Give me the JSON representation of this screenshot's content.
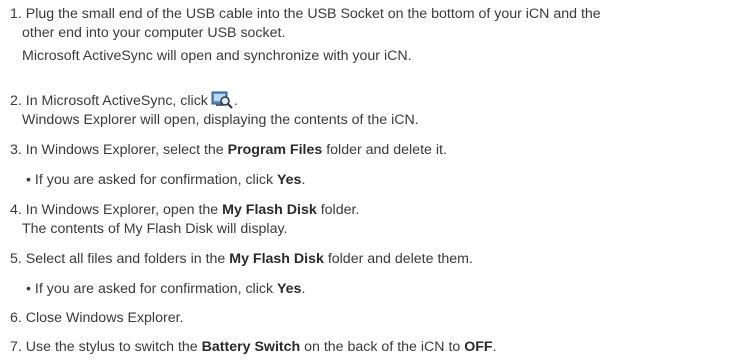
{
  "steps": [
    {
      "line1": "1. Plug the small end of the USB cable into the USB Socket on the bottom of your iCN and the",
      "line2": "other end into your computer USB socket.",
      "line3": "Microsoft ActiveSync will open and synchronize with your iCN."
    },
    {
      "pre": "2. In Microsoft ActiveSync, click",
      "post": ".",
      "line2": "Windows Explorer will open, displaying the contents of the iCN.",
      "icon": "explore-icon"
    },
    {
      "pre": "3. In Windows Explorer, select the ",
      "bold": "Program Files",
      "post": " folder and delete it.",
      "bullet_pre": "• If you are asked for confirmation, click ",
      "bullet_bold": "Yes",
      "bullet_post": "."
    },
    {
      "pre": "4.  In Windows Explorer, open the ",
      "bold": "My Flash Disk",
      "post": " folder.",
      "line2": "The contents of My Flash Disk will display."
    },
    {
      "pre": "5. Select all files and folders in the ",
      "bold": "My Flash Disk",
      "post": " folder and delete them.",
      "bullet_pre": "• If you are asked for confirmation, click ",
      "bullet_bold": "Yes",
      "bullet_post": "."
    },
    {
      "text": "6. Close Windows Explorer."
    },
    {
      "pre": "7. Use the stylus to switch the ",
      "bold": "Battery Switch",
      "post": " on the back of the iCN to ",
      "bold2": "OFF",
      "post2": "."
    }
  ]
}
